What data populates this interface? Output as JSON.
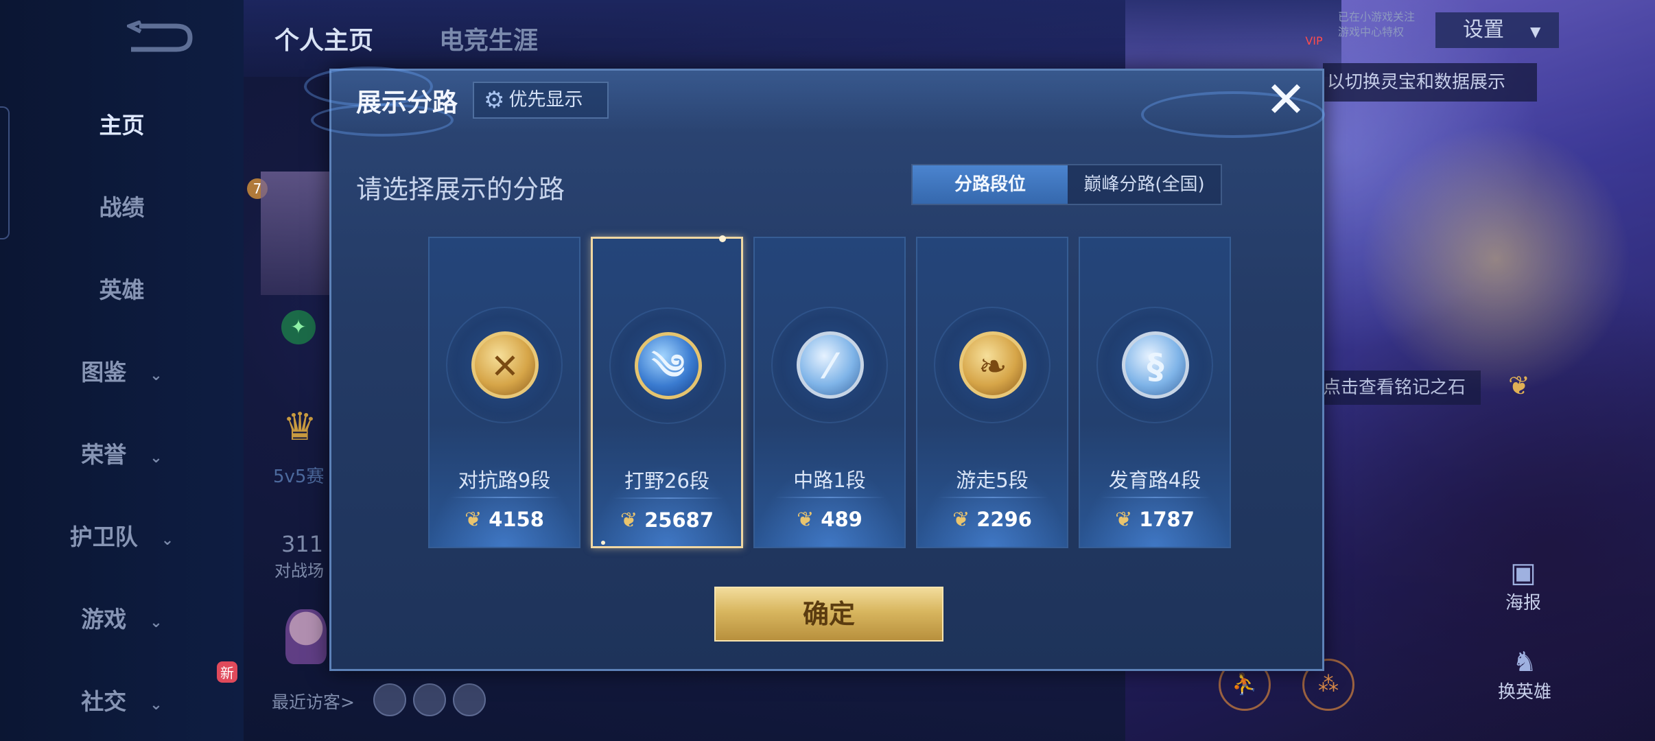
{
  "background": {
    "tabs": [
      "个人主页",
      "电竞生涯"
    ],
    "sidebar": {
      "items": [
        {
          "label": "主页",
          "has_chevron": false
        },
        {
          "label": "战绩",
          "has_chevron": false
        },
        {
          "label": "英雄",
          "has_chevron": false
        },
        {
          "label": "图鉴",
          "has_chevron": true
        },
        {
          "label": "荣誉",
          "has_chevron": true
        },
        {
          "label": "护卫队",
          "has_chevron": true
        },
        {
          "label": "游戏",
          "has_chevron": true
        },
        {
          "label": "社交",
          "has_chevron": true
        }
      ],
      "new_badge": "新"
    },
    "settings_label": "设置",
    "vip_label": "VIP",
    "vip_text_line1": "已在小游戏关注",
    "vip_text_line2": "游戏中心特权",
    "hint": "以切换灵宝和数据展示",
    "mingwen_hint": "点击查看铭记之石",
    "poster_label": "海报",
    "change_hero_label": "换英雄",
    "recent_visitors": "最近访客>",
    "level": "7",
    "mode_text": "5v5赛",
    "stat_value": "311",
    "stat_label": "对战场"
  },
  "dialog": {
    "title": "展示分路",
    "priority_label": "优先显示",
    "subtitle": "请选择展示的分路",
    "toggle": {
      "active": "分路段位",
      "inactive": "巅峰分路(全国)"
    },
    "cards": [
      {
        "label": "对抗路9段",
        "score": "4158",
        "icon": "sword-cross-icon",
        "theme": "gold",
        "selected": false
      },
      {
        "label": "打野26段",
        "score": "25687",
        "icon": "dragon-icon",
        "theme": "blue",
        "selected": true
      },
      {
        "label": "中路1段",
        "score": "489",
        "icon": "slash-icon",
        "theme": "silver",
        "selected": false
      },
      {
        "label": "游走5段",
        "score": "2296",
        "icon": "wings-icon",
        "theme": "gold",
        "selected": false
      },
      {
        "label": "发育路4段",
        "score": "1787",
        "icon": "bow-icon",
        "theme": "silver",
        "selected": false
      }
    ],
    "confirm_label": "确定"
  },
  "colors": {
    "accent_gold": "#d8b65f",
    "toggle_active": "#3568ad",
    "selected_border": "#f0d7a2"
  }
}
